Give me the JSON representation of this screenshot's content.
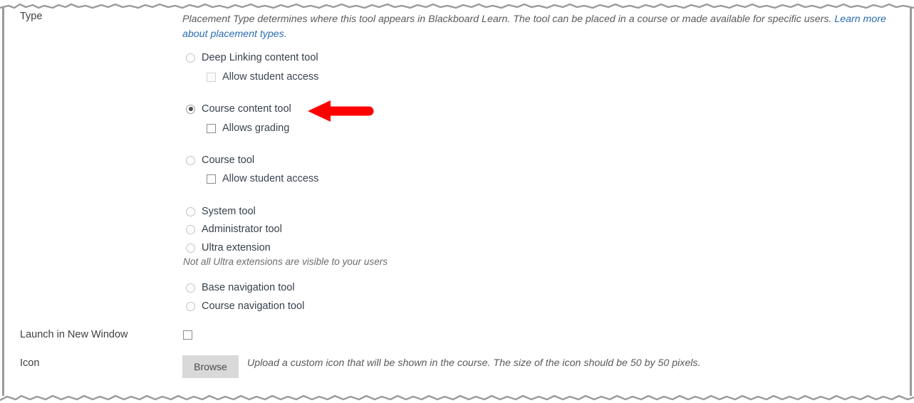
{
  "form": {
    "rows": [
      {
        "label": "Type"
      },
      {
        "label": "Launch in New Window"
      },
      {
        "label": "Icon"
      }
    ],
    "type_label": "Type",
    "launch_label": "Launch in New Window",
    "icon_label": "Icon"
  },
  "description": {
    "text": "Placement Type determines where this tool appears in Blackboard Learn. The tool can be placed in a course or made available for specific users. ",
    "link_text": "Learn more about placement types."
  },
  "placement_options": [
    {
      "id": "deep-linking-content-tool",
      "label": "Deep Linking content tool",
      "selected": false,
      "sub": {
        "id": "allow-student-access-deep-linking",
        "label": "Allow student access",
        "checked": false,
        "muted": true
      }
    },
    {
      "id": "course-content-tool",
      "label": "Course content tool",
      "selected": true,
      "sub": {
        "id": "allows-grading",
        "label": "Allows grading",
        "checked": false,
        "muted": false
      }
    },
    {
      "id": "course-tool",
      "label": "Course tool",
      "selected": false,
      "sub": {
        "id": "allow-student-access-course-tool",
        "label": "Allow student access",
        "checked": false,
        "muted": false
      }
    },
    {
      "id": "system-tool",
      "label": "System tool",
      "selected": false,
      "sub": null
    },
    {
      "id": "administrator-tool",
      "label": "Administrator tool",
      "selected": false,
      "sub": null
    },
    {
      "id": "ultra-extension",
      "label": "Ultra extension",
      "selected": false,
      "sub": null
    },
    {
      "id": "base-navigation-tool",
      "label": "Base navigation tool",
      "selected": false,
      "sub": null
    },
    {
      "id": "course-navigation-tool",
      "label": "Course navigation tool",
      "selected": false,
      "sub": null
    }
  ],
  "ultra_note": "Not all Ultra extensions are visible to your users",
  "launch_in_new_window": {
    "label": "Launch in New Window",
    "checked": false
  },
  "icon": {
    "label": "Icon",
    "browse_button": "Browse",
    "help_text": "Upload a custom icon that will be shown in the course. The size of the icon should be 50 by 50 pixels."
  },
  "annotation": {
    "type": "arrow-left",
    "color": "#FF0000",
    "points_at": "course-content-tool"
  },
  "colors": {
    "link": "#2b6cb0",
    "label_text": "#3f3f3f",
    "option_text": "#353f4a",
    "italic_text": "#5a5a5a",
    "border": "#9a9a9a",
    "button_bg": "#d9d9d9",
    "annotation_red": "#FF0000"
  }
}
